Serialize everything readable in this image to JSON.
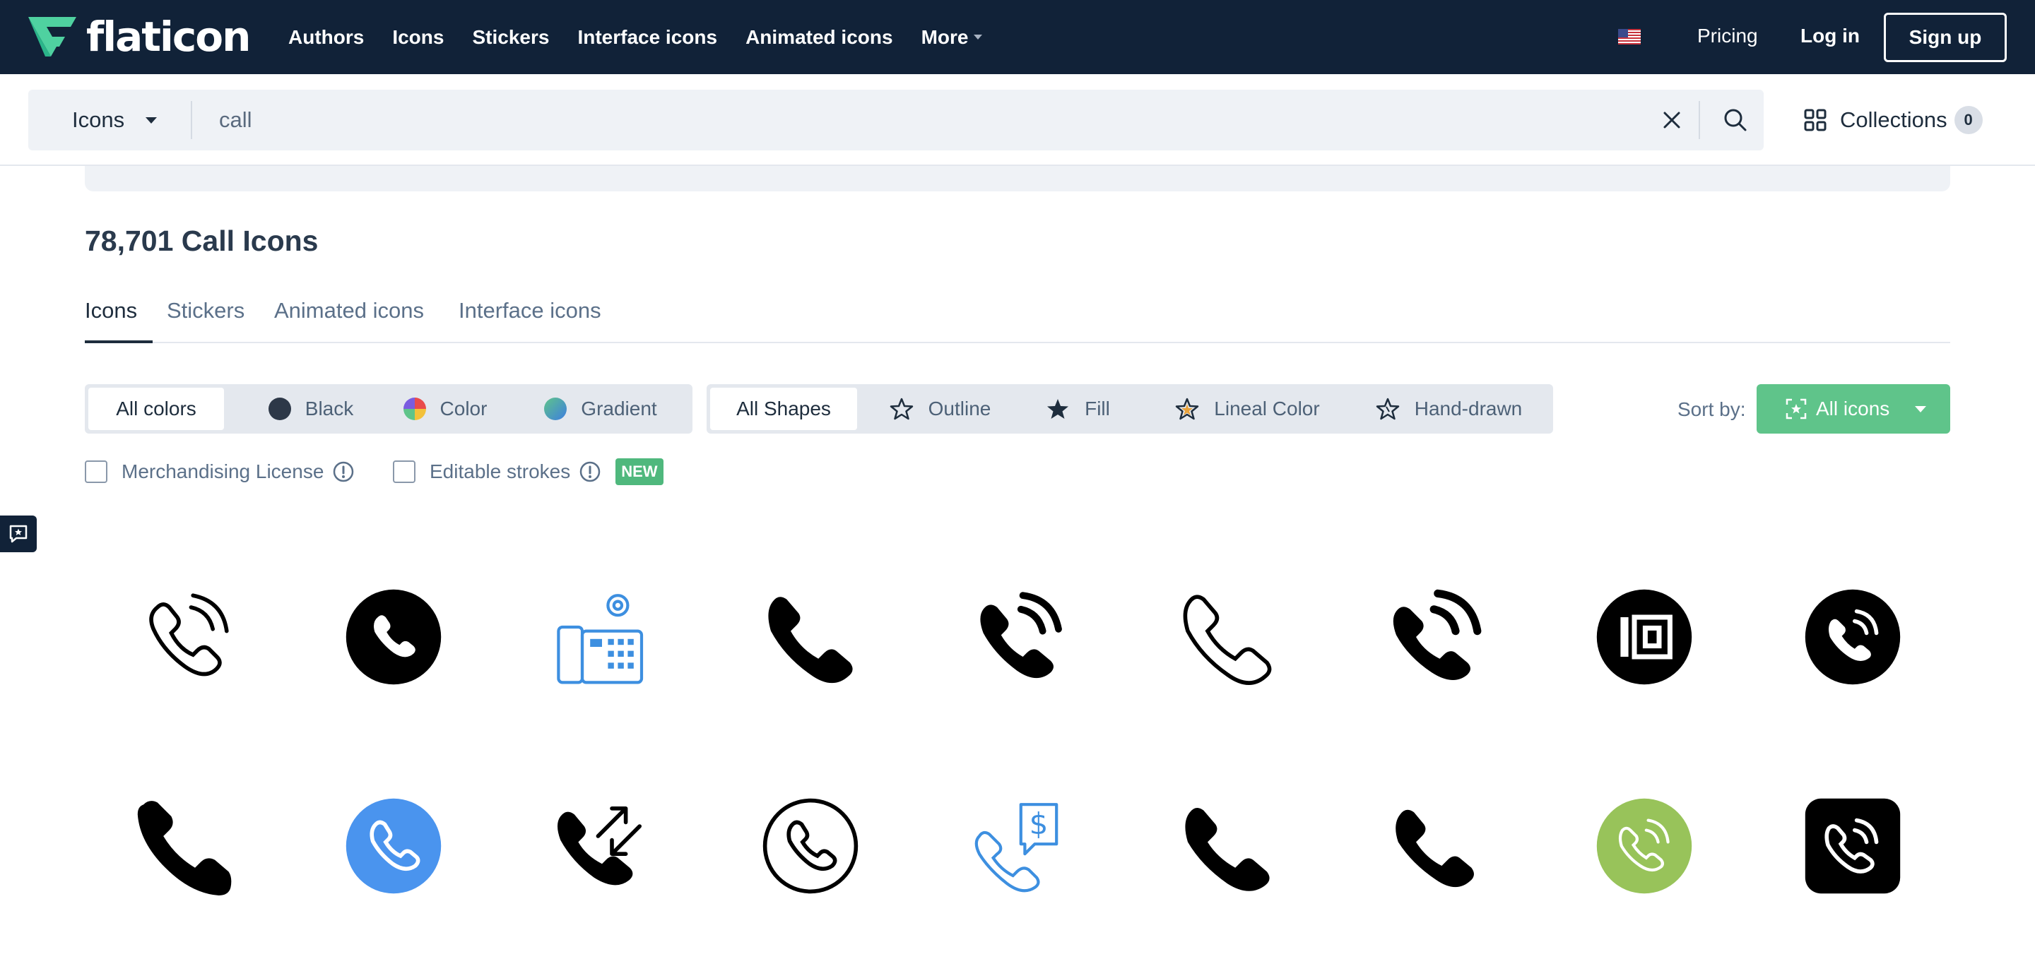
{
  "brand": {
    "name": "flaticon",
    "accent": "#4fd1a0",
    "nav_bg": "#112238"
  },
  "nav": {
    "links": [
      "Authors",
      "Icons",
      "Stickers",
      "Interface icons",
      "Animated icons",
      "More"
    ],
    "pricing": "Pricing",
    "login": "Log in",
    "signup": "Sign up",
    "flag_icon": "us-flag-icon"
  },
  "search": {
    "type": "Icons",
    "query": "call",
    "collections_label": "Collections",
    "collections_count": "0"
  },
  "results": {
    "title": "78,701 Call Icons"
  },
  "tabs": [
    "Icons",
    "Stickers",
    "Animated icons",
    "Interface icons"
  ],
  "filters": {
    "colors": [
      "All colors",
      "Black",
      "Color",
      "Gradient"
    ],
    "shapes": [
      "All Shapes",
      "Outline",
      "Fill",
      "Lineal Color",
      "Hand-drawn"
    ],
    "sort_label": "Sort by:",
    "sort_value": "All icons",
    "merch_license": "Merchandising License",
    "editable_strokes": "Editable strokes",
    "new_badge": "NEW"
  },
  "icons": [
    {
      "name": "phone-ringing-outline-icon",
      "color": "#000000"
    },
    {
      "name": "phone-circle-fill-icon",
      "color": "#000000"
    },
    {
      "name": "office-phone-settings-icon",
      "color": "#3d8fe0"
    },
    {
      "name": "phone-fill-icon",
      "color": "#000000"
    },
    {
      "name": "phone-ringing-fill-icon",
      "color": "#000000"
    },
    {
      "name": "phone-outline-icon",
      "color": "#000000"
    },
    {
      "name": "phone-ringing-bold-icon",
      "color": "#000000"
    },
    {
      "name": "intercom-circle-icon",
      "color": "#000000"
    },
    {
      "name": "phone-ringing-circle-icon",
      "color": "#000000"
    },
    {
      "name": "phone-bold-icon",
      "color": "#000000"
    },
    {
      "name": "phone-circle-blue-icon",
      "color": "#4a94ee"
    },
    {
      "name": "phone-transfer-icon",
      "color": "#000000"
    },
    {
      "name": "phone-circle-outline-icon",
      "color": "#000000"
    },
    {
      "name": "phone-dollar-icon",
      "color": "#3d8fe0"
    },
    {
      "name": "phone-fill-2-icon",
      "color": "#000000"
    },
    {
      "name": "phone-fill-3-icon",
      "color": "#000000"
    },
    {
      "name": "phone-ringing-circle-green-icon",
      "color": "#98c35a"
    },
    {
      "name": "phone-ringing-square-icon",
      "color": "#000000"
    }
  ]
}
